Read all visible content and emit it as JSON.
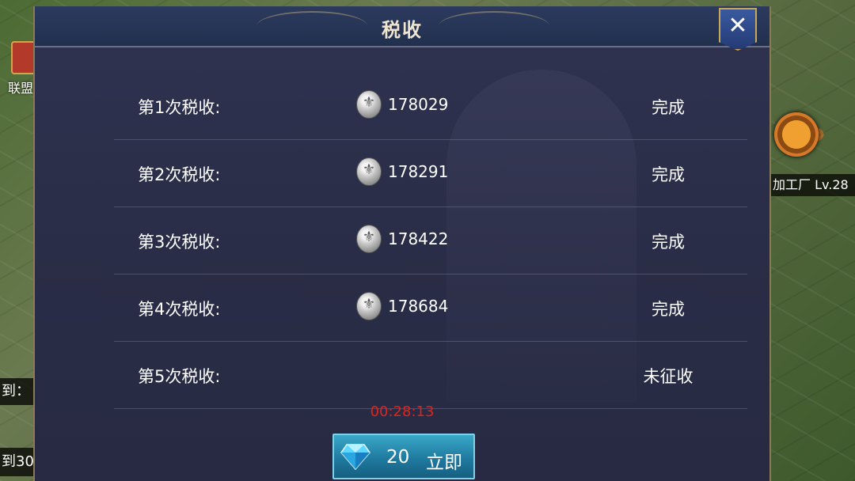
{
  "background": {
    "left_label_1": "联盟",
    "left_bar_1": "到：",
    "left_bar_2": "到30",
    "right_label": "加工厂 Lv.28"
  },
  "dialog": {
    "title": "税收",
    "rows": [
      {
        "label": "第1次税收:",
        "amount": "178029",
        "status": "完成",
        "has_coin": true
      },
      {
        "label": "第2次税收:",
        "amount": "178291",
        "status": "完成",
        "has_coin": true
      },
      {
        "label": "第3次税收:",
        "amount": "178422",
        "status": "完成",
        "has_coin": true
      },
      {
        "label": "第4次税收:",
        "amount": "178684",
        "status": "完成",
        "has_coin": true
      },
      {
        "label": "第5次税收:",
        "amount": "",
        "status": "未征收",
        "has_coin": false
      }
    ],
    "timer": "00:28:13",
    "button": {
      "cost": "20",
      "label": "立即"
    }
  },
  "colors": {
    "timer": "#e0241a",
    "button": "#1f7aa0",
    "panel": "#2a2d47"
  }
}
